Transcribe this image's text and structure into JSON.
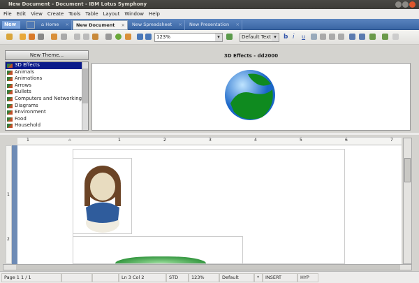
{
  "window": {
    "title": "New Document - Document - IBM Lotus Symphony"
  },
  "menu": [
    "File",
    "Edit",
    "View",
    "Create",
    "Tools",
    "Table",
    "Layout",
    "Window",
    "Help"
  ],
  "tabs": {
    "new_button": "New",
    "items": [
      {
        "label": "Home"
      },
      {
        "label": "New Document"
      },
      {
        "label": "New Spreadsheet"
      },
      {
        "label": "New Presentation"
      }
    ]
  },
  "toolbar": {
    "zoom": "123%",
    "style": "Default Text",
    "bold": "b",
    "italic": "i",
    "underline": "u"
  },
  "gallery": {
    "new_theme": "New Theme...",
    "header": "3D Effects - dd2000",
    "themes": [
      "3D Effects",
      "Animals",
      "Animations",
      "Arrows",
      "Bullets",
      "Computers and Networking",
      "Diagrams",
      "Environment",
      "Food",
      "Household"
    ],
    "selected": 0
  },
  "ruler": {
    "h": [
      "1",
      "1",
      "2",
      "3",
      "4",
      "5",
      "6",
      "7"
    ],
    "v": [
      "1",
      "2"
    ]
  },
  "status": {
    "page": "Page 1  1 / 1",
    "position": "Ln 3 Col 2",
    "mode": "STD",
    "zoom": "123%",
    "style": "Default",
    "modified": "*",
    "insert": "INSERT",
    "hyp": "HYP"
  }
}
